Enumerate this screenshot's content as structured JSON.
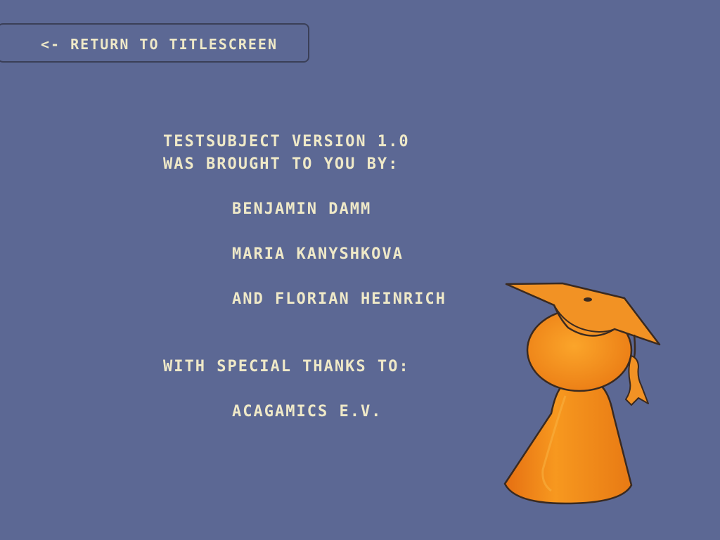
{
  "navigation": {
    "back_label": "<- return to titlescreen"
  },
  "credits": {
    "version_line": "testsubject version  1.0",
    "brought_line": "was brought to you by:",
    "authors": [
      "benjamin damm",
      "maria kanyshkova",
      "and florian heinrich"
    ],
    "thanks_heading": "with special thanks to:",
    "thanks": [
      "acagamics e.v."
    ]
  },
  "mascot": {
    "icon": "graduation-pawn-icon"
  },
  "colors": {
    "background": "#5c6894",
    "text": "#efe9c8",
    "mascot_orange": "#f08a1c",
    "outline": "#3a3f57"
  }
}
